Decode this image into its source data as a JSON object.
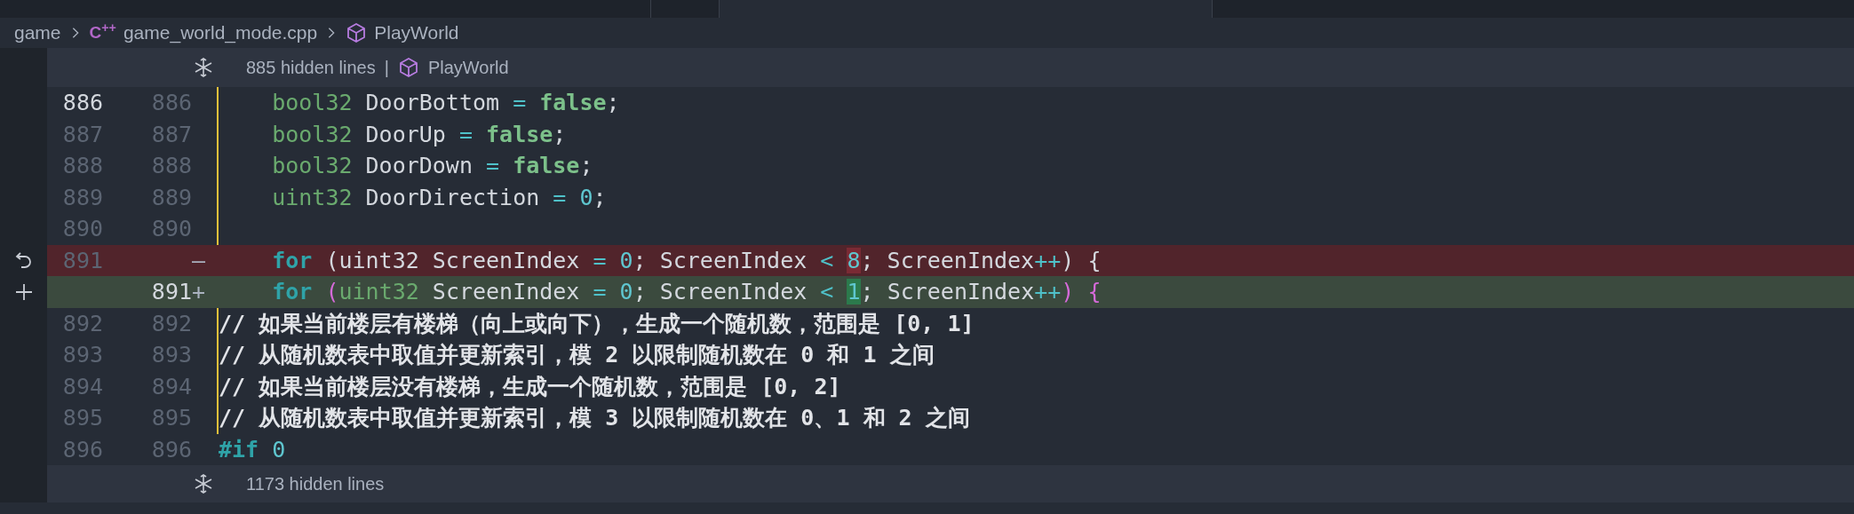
{
  "breadcrumb": [
    {
      "kind": "folder",
      "label": "game"
    },
    {
      "kind": "file",
      "label": "game_world_mode.cpp",
      "badge": "C$^{++}$"
    },
    {
      "kind": "symbol",
      "label": "PlayWorld"
    }
  ],
  "top_fold": {
    "label": "885 hidden lines",
    "separator": "|",
    "symbol": "PlayWorld"
  },
  "lines": [
    {
      "old": "886",
      "new": "886",
      "kind": "modified",
      "current": true,
      "tokens": [
        {
          "kind": "type",
          "text": "    bool32"
        },
        {
          "kind": "plain",
          "text": " DoorBottom "
        },
        {
          "kind": "op",
          "text": "= "
        },
        {
          "kind": "bool",
          "text": "false"
        },
        {
          "kind": "plain",
          "text": ";"
        }
      ]
    },
    {
      "old": "887",
      "new": "887",
      "kind": "modified",
      "current": false,
      "tokens": [
        {
          "kind": "type",
          "text": "    bool32"
        },
        {
          "kind": "plain",
          "text": " DoorUp "
        },
        {
          "kind": "op",
          "text": "= "
        },
        {
          "kind": "bool",
          "text": "false"
        },
        {
          "kind": "plain",
          "text": ";"
        }
      ]
    },
    {
      "old": "888",
      "new": "888",
      "kind": "modified",
      "current": false,
      "tokens": [
        {
          "kind": "type",
          "text": "    bool32"
        },
        {
          "kind": "plain",
          "text": " DoorDown "
        },
        {
          "kind": "op",
          "text": "= "
        },
        {
          "kind": "bool",
          "text": "false"
        },
        {
          "kind": "plain",
          "text": ";"
        }
      ]
    },
    {
      "old": "889",
      "new": "889",
      "kind": "modified",
      "current": false,
      "tokens": [
        {
          "kind": "type",
          "text": "    uint32"
        },
        {
          "kind": "plain",
          "text": " DoorDirection "
        },
        {
          "kind": "op",
          "text": "= "
        },
        {
          "kind": "number",
          "text": "0"
        },
        {
          "kind": "plain",
          "text": ";"
        }
      ]
    },
    {
      "old": "890",
      "new": "890",
      "kind": "modified",
      "current": false
    },
    {
      "old": "891",
      "marker": "—",
      "kind": "deleted",
      "current": false,
      "tokens": [
        {
          "kind": "keyword",
          "text": "    for"
        },
        {
          "kind": "plain",
          "text": " (uint32 ScreenIndex "
        },
        {
          "kind": "op",
          "text": "= "
        },
        {
          "kind": "number",
          "text": "0"
        },
        {
          "kind": "plain",
          "text": "; ScreenIndex "
        },
        {
          "kind": "op",
          "text": "< "
        },
        {
          "kind": "changed-number",
          "text": "8"
        },
        {
          "kind": "plain",
          "text": "; ScreenIndex"
        },
        {
          "kind": "op",
          "text": "++"
        },
        {
          "kind": "plain",
          "text": ") {"
        }
      ]
    },
    {
      "new": "891",
      "marker": "+",
      "kind": "added",
      "current": true,
      "tokens": [
        {
          "kind": "keyword",
          "text": "    for "
        },
        {
          "kind": "paren",
          "text": "("
        },
        {
          "kind": "type",
          "text": "uint32"
        },
        {
          "kind": "plain",
          "text": " ScreenIndex "
        },
        {
          "kind": "op",
          "text": "= "
        },
        {
          "kind": "number",
          "text": "0"
        },
        {
          "kind": "plain",
          "text": "; ScreenIndex "
        },
        {
          "kind": "op",
          "text": "< "
        },
        {
          "kind": "changed-number",
          "text": "1"
        },
        {
          "kind": "plain",
          "text": "; ScreenIndex"
        },
        {
          "kind": "op",
          "text": "++"
        },
        {
          "kind": "paren",
          "text": ") {"
        }
      ]
    },
    {
      "old": "892",
      "new": "892",
      "kind": "modified",
      "current": false,
      "tokens": [
        {
          "kind": "comment",
          "text": "// 如果当前楼层有楼梯（向上或向下），生成一个随机数，范围是 [0, 1]"
        }
      ]
    },
    {
      "old": "893",
      "new": "893",
      "kind": "modified",
      "current": false,
      "tokens": [
        {
          "kind": "comment",
          "text": "// 从随机数表中取值并更新索引，模 2 以限制随机数在 0 和 1 之间"
        }
      ]
    },
    {
      "old": "894",
      "new": "894",
      "kind": "modified",
      "current": false,
      "tokens": [
        {
          "kind": "comment",
          "text": "// 如果当前楼层没有楼梯，生成一个随机数，范围是 [0, 2]"
        }
      ]
    },
    {
      "old": "895",
      "new": "895",
      "kind": "modified",
      "current": false,
      "tokens": [
        {
          "kind": "comment",
          "text": "// 从随机数表中取值并更新索引，模 3 以限制随机数在 0、1 和 2 之间"
        }
      ]
    },
    {
      "old": "896",
      "new": "896",
      "kind": "context",
      "current": false,
      "tokens": [
        {
          "kind": "directive",
          "text": "#if "
        },
        {
          "kind": "number",
          "text": "0"
        }
      ]
    }
  ],
  "bottom_fold": {
    "label": "1173 hidden lines"
  }
}
